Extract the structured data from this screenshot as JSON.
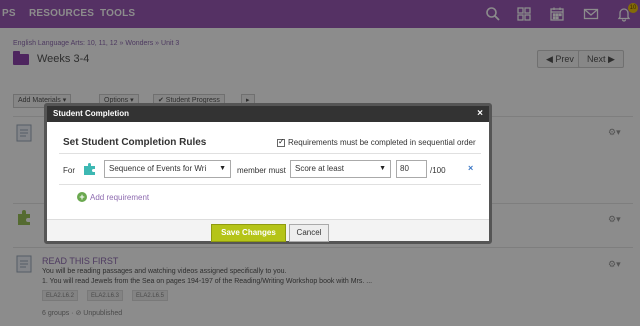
{
  "topnav": {
    "items": [
      "PS",
      "RESOURCES",
      "TOOLS"
    ],
    "notification_count": "10"
  },
  "page": {
    "breadcrumb": "English Language Arts: 10, 11, 12 » Wonders » Unit 3",
    "title": "Weeks 3-4",
    "prev_label": "◀ Prev",
    "next_label": "Next ▶",
    "toolbar": {
      "add_materials": "Add Materials ▾",
      "options": "Options ▾",
      "student_progress": "✔ Student Progress"
    },
    "items": [
      {
        "title": "READ THIS FIRST",
        "desc1": "You will be reading passages and watching videos assigned specifically to you.",
        "desc2": "1.  You will read Jewels from the Sea on pages 194-197 of the Reading/Writing Workshop book with Mrs. ...",
        "tags": [
          "ELA2.L6.2",
          "ELA2.L6.3",
          "ELA2.L6.5"
        ],
        "meta": "6 groups · ⊘ Unpublished"
      }
    ]
  },
  "modal": {
    "title": "Student Completion",
    "close": "×",
    "rules_title": "Set Student Completion Rules",
    "sequential_label": "Requirements must be completed in sequential order",
    "for_label": "For",
    "material_select": "Sequence of Events for Wri",
    "member_must": "member must",
    "rule_select": "Score at least",
    "score_value": "80",
    "score_max": "/100",
    "remove": "×",
    "add_requirement": "Add requirement",
    "save_label": "Save Changes",
    "cancel_label": "Cancel"
  },
  "colors": {
    "nav": "#9b59b6",
    "accent": "#8e6bb0",
    "save": "#b5c418"
  }
}
